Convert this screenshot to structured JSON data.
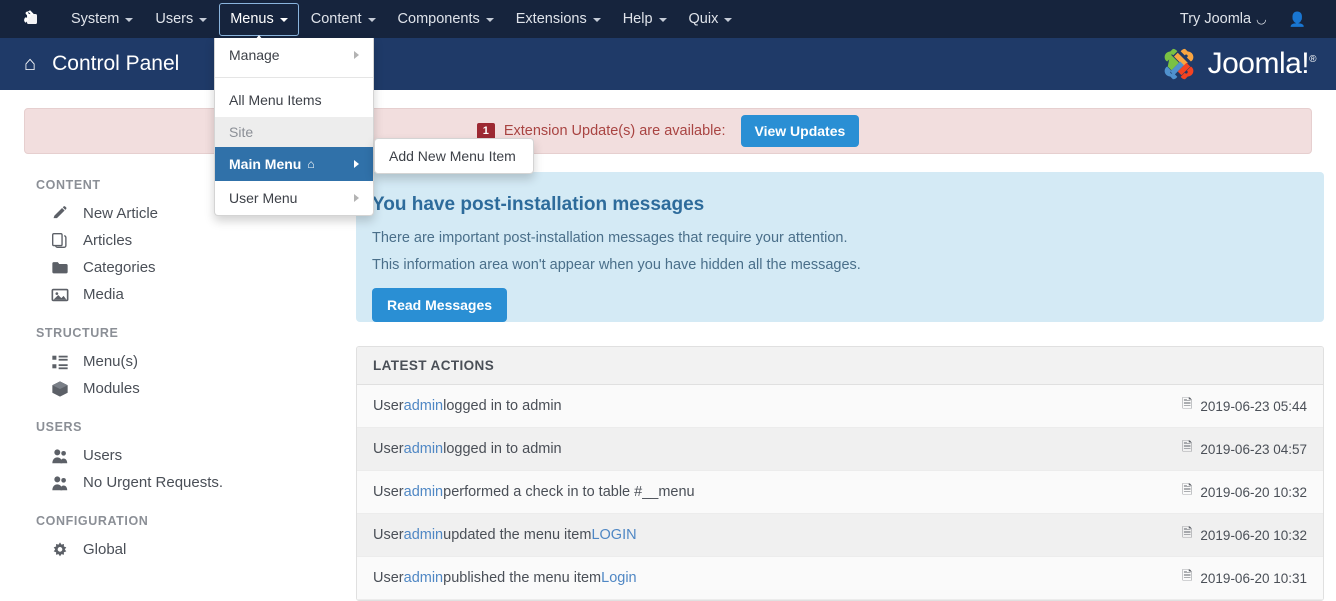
{
  "topbar": {
    "logo_icon": "joomla-logo-icon",
    "nav": [
      {
        "label": "System",
        "caret": true,
        "active": false
      },
      {
        "label": "Users",
        "caret": true,
        "active": false
      },
      {
        "label": "Menus",
        "caret": true,
        "active": true
      },
      {
        "label": "Content",
        "caret": true,
        "active": false
      },
      {
        "label": "Components",
        "caret": true,
        "active": false
      },
      {
        "label": "Extensions",
        "caret": true,
        "active": false
      },
      {
        "label": "Help",
        "caret": true,
        "active": false
      },
      {
        "label": "Quix",
        "caret": true,
        "active": false
      }
    ],
    "try_joomla": "Try Joomla",
    "external_link_icon": "↗",
    "user_icon": "person-icon"
  },
  "subheader": {
    "home_icon": "home-icon",
    "title": "Control Panel",
    "brand": "Joomla!",
    "brand_sup": "®"
  },
  "alert": {
    "badge": "1",
    "text": "Extension Update(s) are available:",
    "button": "View Updates",
    "badge_color": "#9d2933",
    "bg_color": "#f2dede",
    "button_color": "#2a8fd4"
  },
  "menus_dropdown": {
    "items": [
      {
        "label": "Manage",
        "type": "item",
        "caret": true,
        "selected": false
      },
      {
        "type": "divider"
      },
      {
        "label": "All Menu Items",
        "type": "item",
        "caret": false,
        "selected": false
      },
      {
        "label": "Site",
        "type": "header"
      },
      {
        "label": "Main Menu",
        "type": "item",
        "caret": true,
        "selected": true,
        "home": true
      },
      {
        "label": "User Menu",
        "type": "item",
        "caret": true,
        "selected": false
      }
    ],
    "submenu": [
      {
        "label": "Add New Menu Item"
      }
    ],
    "highlight_color": "#3071a9"
  },
  "sidebar": {
    "sections": [
      {
        "title": "CONTENT",
        "items": [
          {
            "label": "New Article",
            "icon": "pencil-icon"
          },
          {
            "label": "Articles",
            "icon": "copy-icon"
          },
          {
            "label": "Categories",
            "icon": "folder-icon"
          },
          {
            "label": "Media",
            "icon": "image-icon"
          }
        ]
      },
      {
        "title": "STRUCTURE",
        "items": [
          {
            "label": "Menu(s)",
            "icon": "list-icon"
          },
          {
            "label": "Modules",
            "icon": "cube-icon"
          }
        ]
      },
      {
        "title": "USERS",
        "items": [
          {
            "label": "Users",
            "icon": "users-icon"
          },
          {
            "label": "No Urgent Requests.",
            "icon": "users-icon"
          }
        ]
      },
      {
        "title": "CONFIGURATION",
        "items": [
          {
            "label": "Global",
            "icon": "gear-icon"
          }
        ]
      }
    ]
  },
  "postinstall": {
    "title": "You have post-installation messages",
    "line1": "There are important post-installation messages that require your attention.",
    "line2": "This information area won't appear when you have hidden all the messages.",
    "button": "Read Messages",
    "bg_color": "#d4eaf5"
  },
  "latest_actions": {
    "header": "LATEST ACTIONS",
    "rows": [
      {
        "pre": "User ",
        "link": "admin",
        "post": " logged in to admin",
        "link2": "",
        "date": "2019-06-23 05:44"
      },
      {
        "pre": "User ",
        "link": "admin",
        "post": " logged in to admin",
        "link2": "",
        "date": "2019-06-23 04:57"
      },
      {
        "pre": "User ",
        "link": "admin",
        "post": " performed a check in to table #__menu",
        "link2": "",
        "date": "2019-06-20 10:32"
      },
      {
        "pre": "User ",
        "link": "admin",
        "post": " updated the menu item ",
        "link2": "LOGIN",
        "date": "2019-06-20 10:32"
      },
      {
        "pre": "User ",
        "link": "admin",
        "post": " published the menu item ",
        "link2": "Login",
        "date": "2019-06-20 10:31"
      }
    ],
    "calendar_icon": "calendar-icon"
  }
}
